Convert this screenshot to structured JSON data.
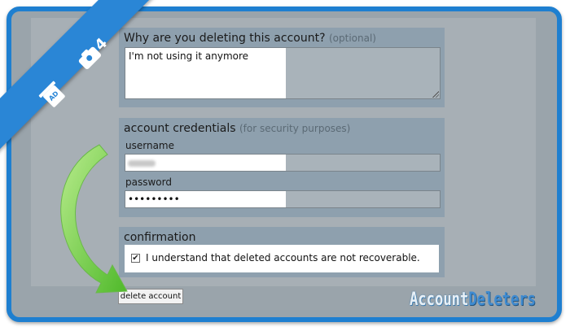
{
  "step": {
    "number": "4"
  },
  "reason_section": {
    "title": "Why are you deleting this account?",
    "title_note": "(optional)",
    "value": "I'm not using it anymore"
  },
  "credentials_section": {
    "title": "account credentials",
    "title_note": "(for security purposes)",
    "username_label": "username",
    "username_value": "",
    "password_label": "password",
    "password_value": "•••••••••"
  },
  "confirmation_section": {
    "title": "confirmation",
    "checkbox_label": "I understand that deleted accounts are not recoverable.",
    "checked": true,
    "check_glyph": "✔"
  },
  "delete_button": {
    "label": "delete account"
  },
  "brand": {
    "part1": "Account",
    "part2": "Deleters"
  },
  "colors": {
    "accent": "#2a86d6",
    "arrow": "#5cc23a",
    "panel": "#8ea0ae"
  },
  "icons": [
    "camera-icon",
    "trash-ad-icon",
    "curved-arrow-icon",
    "resize-grip-icon",
    "checkbox-icon"
  ]
}
